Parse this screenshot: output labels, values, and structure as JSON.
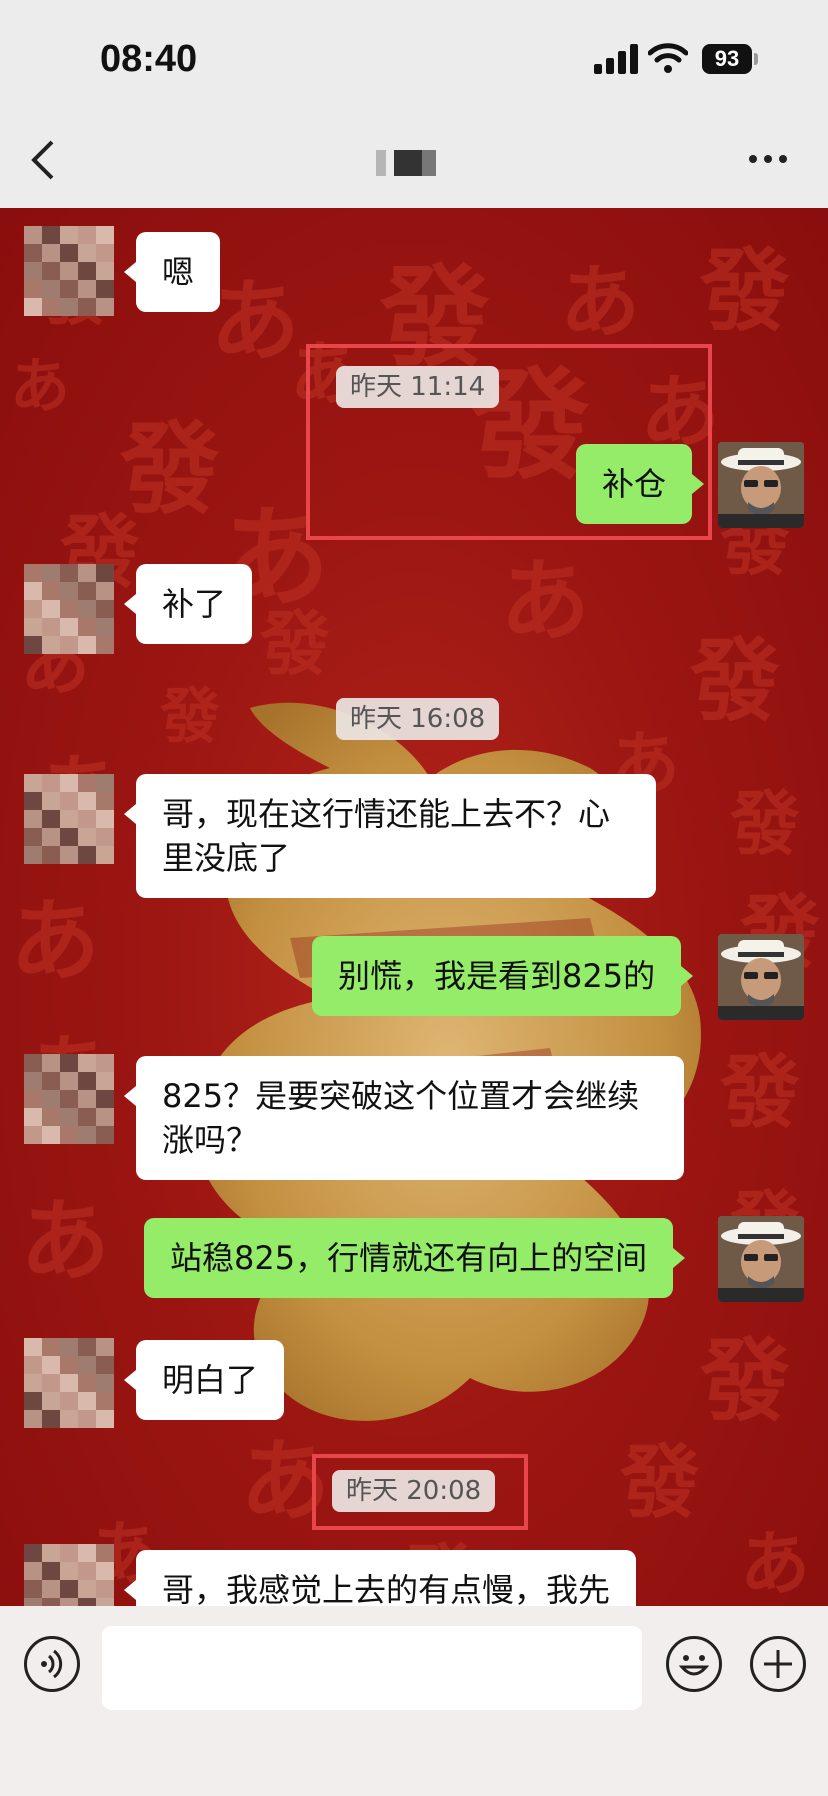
{
  "status_bar": {
    "time": "08:40",
    "battery": "93"
  },
  "nav": {
    "back_icon": "chevron-left-icon",
    "more_icon": "more-dots-icon"
  },
  "messages": [
    {
      "id": "m1",
      "side": "in",
      "text": "嗯"
    },
    {
      "id": "t1",
      "type": "timestamp",
      "text": "昨天 11:14"
    },
    {
      "id": "m2",
      "side": "out",
      "text": "补仓"
    },
    {
      "id": "m3",
      "side": "in",
      "text": "补了"
    },
    {
      "id": "t2",
      "type": "timestamp",
      "text": "昨天 16:08"
    },
    {
      "id": "m4",
      "side": "in",
      "text": "哥，现在这行情还能上去不？心\n里没底了"
    },
    {
      "id": "m5",
      "side": "out",
      "text": "别慌，我是看到825的"
    },
    {
      "id": "m6",
      "side": "in",
      "text": "825？是要突破这个位置才会继续\n涨吗？"
    },
    {
      "id": "m7",
      "side": "out",
      "text": "站稳825，行情就还有向上的空间"
    },
    {
      "id": "m8",
      "side": "in",
      "text": "明白了"
    },
    {
      "id": "t3",
      "type": "timestamp",
      "text": "昨天 20:08"
    },
    {
      "id": "m9",
      "side": "in",
      "text": "哥，我感觉上去的有点慢，我先"
    }
  ],
  "background": {
    "char_a": "發",
    "char_b": "あ",
    "colors": {
      "red": "#9c1612",
      "gold": "#c9a24a",
      "highlight": "#e8464a",
      "out_bubble": "#95ec69"
    }
  },
  "input_bar": {
    "voice_icon": "voice-icon",
    "emoji_icon": "emoji-icon",
    "plus_icon": "plus-icon"
  }
}
